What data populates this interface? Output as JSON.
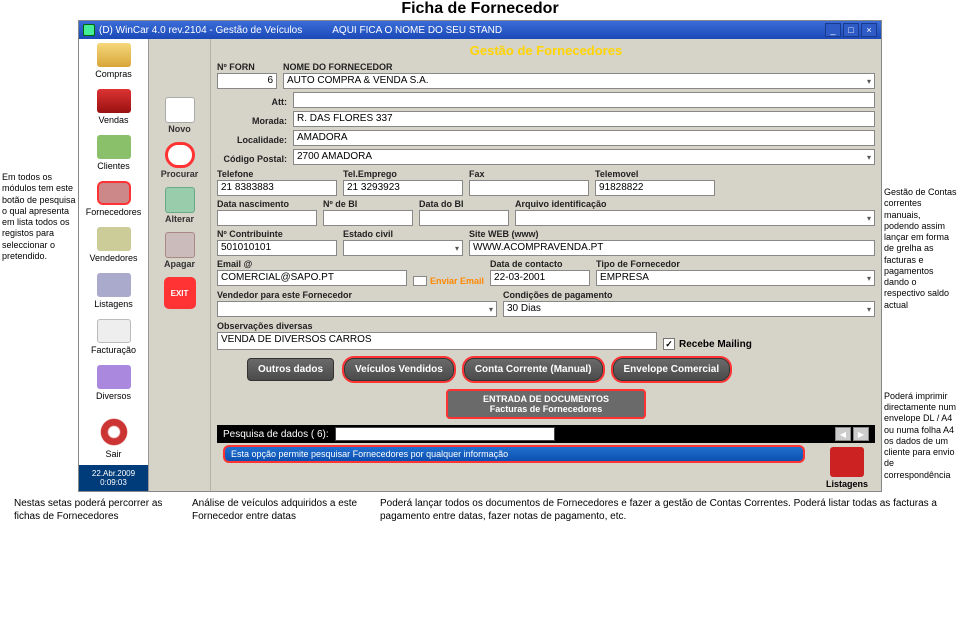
{
  "page_title": "Ficha de Fornecedor",
  "annotations": {
    "left": "Em todos os módulos tem este botão de pesquisa o qual apresenta em lista todos os registos para seleccionar o pretendido.",
    "right1": "Gestão de Contas correntes manuais, podendo assim lançar em forma de grelha as facturas e pagamentos dando o respectivo saldo actual",
    "right2": "Poderá imprimir directamente num envelope DL / A4 ou numa folha A4 os dados de um cliente para envio de correspondência",
    "bottom1": "Nestas setas poderá percorrer as fichas de Fornecedores",
    "bottom2": "Análise de veículos adquiridos a este Fornecedor entre datas",
    "bottom3": "Poderá lançar todos os documentos de Fornecedores e fazer a gestão de Contas Correntes. Poderá listar todas as facturas a pagamento entre datas, fazer notas de pagamento, etc."
  },
  "titlebar": {
    "app": "(D)  WinCar 4.0 rev.2104  -  Gestão de Veículos",
    "stand": "AQUI FICA O NOME DO SEU STAND"
  },
  "module_title": "Gestão de Fornecedores",
  "sidebar": {
    "items": [
      "Compras",
      "Vendas",
      "Clientes",
      "Fornecedores",
      "Vendedores",
      "Listagens",
      "Facturação",
      "Diversos"
    ],
    "date": "22.Abr.2009",
    "time": "0:09:03",
    "sair_label": "Sair"
  },
  "toolcol": {
    "items": [
      "Novo",
      "Procurar",
      "Alterar",
      "Apagar"
    ],
    "exit": "EXIT"
  },
  "form": {
    "nforn_label": "Nº FORN",
    "nforn": "6",
    "nome_label": "NOME DO FORNECEDOR",
    "nome": "AUTO COMPRA & VENDA S.A.",
    "att_label": "Att:",
    "att": "",
    "morada_label": "Morada:",
    "morada": "R. DAS FLORES 337",
    "localidade_label": "Localidade:",
    "localidade": "AMADORA",
    "cp_label": "Código Postal:",
    "cp": "2700 AMADORA",
    "telefone_label": "Telefone",
    "telefone": "21 8383883",
    "telemp_label": "Tel.Emprego",
    "telemp": "21 3293923",
    "fax_label": "Fax",
    "fax": "",
    "telemovel_label": "Telemovel",
    "telemovel": "91828822",
    "datanasc_label": "Data nascimento",
    "datanasc": "",
    "nbi_label": "Nº de BI",
    "nbi": "",
    "databi_label": "Data do BI",
    "databi": "",
    "arquivo_label": "Arquivo identificação",
    "arquivo": "",
    "ncontr_label": "Nº Contribuinte",
    "ncontr": "501010101",
    "estadocivil_label": "Estado civil",
    "estadocivil": "",
    "siteweb_label": "Site WEB (www)",
    "siteweb": "WWW.ACOMPRAVENDA.PT",
    "email_label": "Email @",
    "email": "COMERCIAL@SAPO.PT",
    "enviar_email": "Enviar Email",
    "datacontacto_label": "Data de contacto",
    "datacontacto": "22-03-2001",
    "tipoforn_label": "Tipo de Fornecedor",
    "tipoforn": "EMPRESA",
    "vendedor_label": "Vendedor para este Fornecedor",
    "vendedor": "",
    "condpag_label": "Condições de pagamento",
    "condpag": "30 Dias",
    "obs_label": "Observações diversas",
    "obs": "VENDA DE DIVERSOS CARROS",
    "recebe_mailing": "Recebe Mailing"
  },
  "buttons": {
    "outros": "Outros dados",
    "veiculos": "Veículos Vendidos",
    "ccorrente": "Conta Corrente (Manual)",
    "envelope": "Envelope Comercial"
  },
  "centerbox": {
    "line1": "ENTRADA DE DOCUMENTOS",
    "line2": "Facturas de Fornecedores"
  },
  "searchbar": {
    "label": "Pesquisa de dados ( 6):"
  },
  "tipbar": "Esta opção permite pesquisar Fornecedores por qualquer informação",
  "listagens_side": "Listagens"
}
